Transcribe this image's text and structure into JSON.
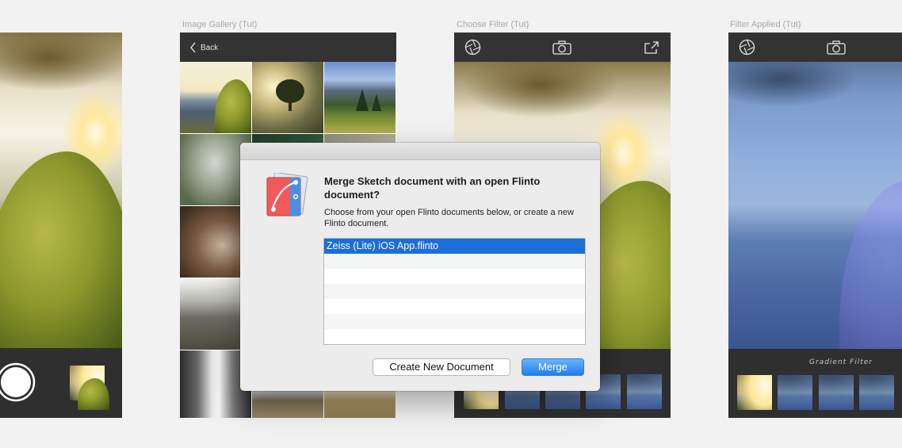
{
  "artboards": {
    "gallery_title": "Image Gallery (Tut)",
    "choose_filter_title": "Choose Filter (Tut)",
    "filter_applied_title": "Filter Applied (Tut)"
  },
  "gallery": {
    "back_label": "Back"
  },
  "filter_applied": {
    "filter_name": "Gradient Filter"
  },
  "dialog": {
    "title": "Merge Sketch document with an open Flinto document?",
    "message": "Choose from your open Flinto documents below, or create a new Flinto document.",
    "documents": [
      "Zeiss (Lite) iOS App.flinto"
    ],
    "selected_document": "Zeiss (Lite) iOS App.flinto",
    "create_button": "Create New Document",
    "merge_button": "Merge"
  },
  "icons": {
    "filter": "aperture-icon",
    "camera": "camera-icon",
    "share": "share-icon",
    "back": "chevron-left-icon",
    "shutter": "shutter-button",
    "app": "flinto-app-icon"
  },
  "colors": {
    "accent": "#1c6ed8",
    "navbar": "#333333",
    "canvas": "#f2f2f2"
  }
}
